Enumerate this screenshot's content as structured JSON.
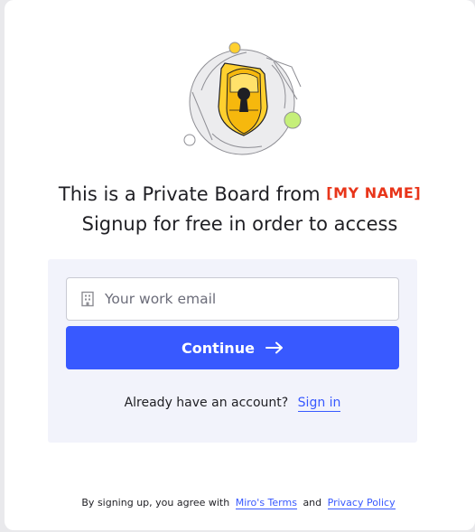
{
  "heading": {
    "title_prefix": "This is a Private Board from",
    "owner_name": "[MY NAME]",
    "subtitle": "Signup for free in order to access"
  },
  "form": {
    "email_placeholder": "Your work email",
    "email_value": "",
    "continue_label": "Continue",
    "already_text": "Already have an account?",
    "sign_in_label": "Sign in"
  },
  "legal": {
    "prefix": "By signing up, you agree with",
    "terms_label": "Miro's Terms",
    "and_text": "and",
    "privacy_label": "Privacy Policy"
  },
  "icons": {
    "illustration": "lock-shield-illustration",
    "email": "building-icon",
    "continue": "arrow-right-icon"
  },
  "colors": {
    "accent": "#3859ff",
    "owner_name": "#e8351a",
    "panel_bg": "#f2f3fb",
    "lock_yellow": "#ffd02f",
    "dot_green": "#c5ef79"
  }
}
